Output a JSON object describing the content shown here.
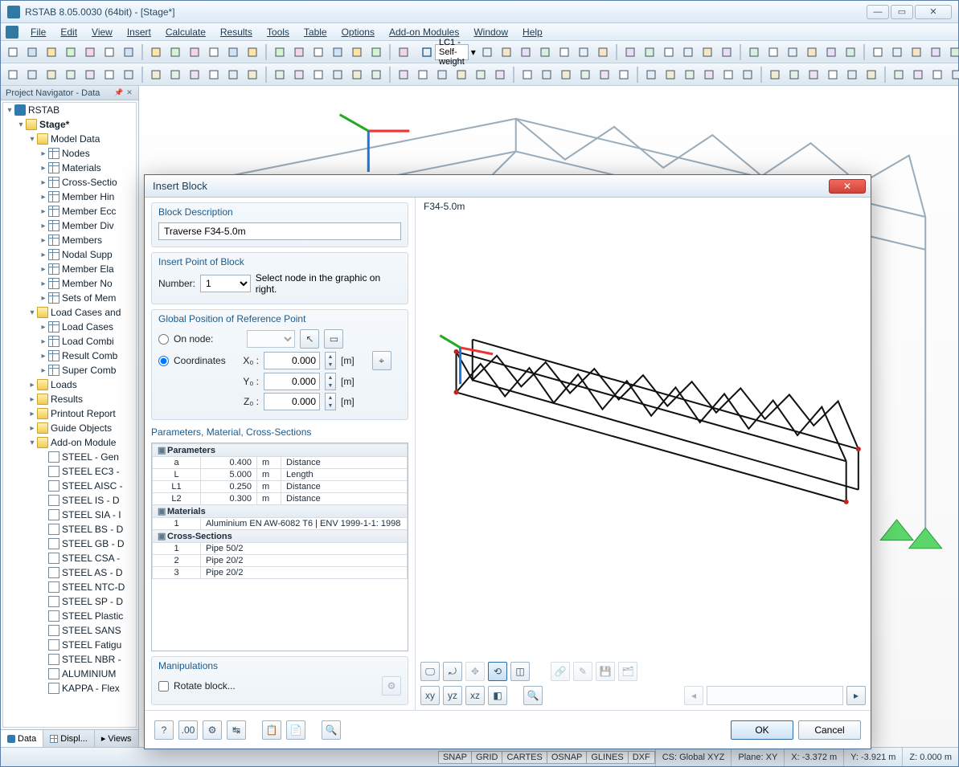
{
  "window": {
    "title": "RSTAB 8.05.0030 (64bit) - [Stage*]",
    "buttons": {
      "min": "—",
      "max": "▭",
      "close": "✕"
    }
  },
  "menubar": [
    "File",
    "Edit",
    "View",
    "Insert",
    "Calculate",
    "Results",
    "Tools",
    "Table",
    "Options",
    "Add-on Modules",
    "Window",
    "Help"
  ],
  "loadcase_combo": "LC1 - Self-weight",
  "navigator": {
    "title": "Project Navigator - Data",
    "tabs": [
      "Data",
      "Displ...",
      "Views"
    ],
    "root": "RSTAB",
    "project": "Stage*",
    "model_data_label": "Model Data",
    "model_data": [
      "Nodes",
      "Materials",
      "Cross-Sectio",
      "Member Hin",
      "Member Ecc",
      "Member Div",
      "Members",
      "Nodal Supp",
      "Member Ela",
      "Member No",
      "Sets of Mem"
    ],
    "loadcases_label": "Load Cases and",
    "loadcases": [
      "Load Cases",
      "Load Combi",
      "Result Comb",
      "Super Comb"
    ],
    "others": [
      "Loads",
      "Results",
      "Printout Report",
      "Guide Objects"
    ],
    "addon_label": "Add-on Module",
    "addons": [
      "STEEL - Gen",
      "STEEL EC3 -",
      "STEEL AISC -",
      "STEEL IS - D",
      "STEEL SIA - I",
      "STEEL BS - D",
      "STEEL GB - D",
      "STEEL CSA -",
      "STEEL AS - D",
      "STEEL NTC-D",
      "STEEL SP - D",
      "STEEL Plastic",
      "STEEL SANS ",
      "STEEL Fatigu",
      "STEEL NBR -",
      "ALUMINIUM",
      "KAPPA - Flex"
    ]
  },
  "dialog": {
    "title": "Insert Block",
    "groups": {
      "desc": {
        "legend": "Block Description",
        "value": "Traverse F34-5.0m"
      },
      "insert": {
        "legend": "Insert Point of Block",
        "number_label": "Number:",
        "number_value": "1",
        "hint": "Select node in the graphic on right."
      },
      "global": {
        "legend": "Global Position of Reference Point",
        "on_node": "On node:",
        "coords": "Coordinates",
        "x_label": "X₀ :",
        "x_val": "0.000",
        "x_unit": "[m]",
        "y_label": "Y₀ :",
        "y_val": "0.000",
        "y_unit": "[m]",
        "z_label": "Z₀ :",
        "z_val": "0.000",
        "z_unit": "[m]"
      },
      "params": {
        "legend": "Parameters, Material, Cross-Sections",
        "sections": {
          "parameters": "Parameters",
          "materials": "Materials",
          "cross": "Cross-Sections"
        },
        "rows": [
          {
            "k": "a",
            "v": "0.400",
            "u": "m",
            "d": "Distance"
          },
          {
            "k": "L",
            "v": "5.000",
            "u": "m",
            "d": "Length"
          },
          {
            "k": "L1",
            "v": "0.250",
            "u": "m",
            "d": "Distance"
          },
          {
            "k": "L2",
            "v": "0.300",
            "u": "m",
            "d": "Distance"
          }
        ],
        "materials": [
          {
            "n": "1",
            "t": "Aluminium EN AW-6082 T6 | ENV 1999-1-1: 1998"
          }
        ],
        "cross": [
          {
            "n": "1",
            "t": "Pipe 50/2"
          },
          {
            "n": "2",
            "t": "Pipe 20/2"
          },
          {
            "n": "3",
            "t": "Pipe 20/2"
          }
        ]
      },
      "manip": {
        "legend": "Manipulations",
        "rotate": "Rotate block..."
      }
    },
    "preview_title": "F34-5.0m",
    "buttons": {
      "ok": "OK",
      "cancel": "Cancel"
    }
  },
  "statusbar": {
    "toggles": [
      "SNAP",
      "GRID",
      "CARTES",
      "OSNAP",
      "GLINES",
      "DXF"
    ],
    "cs": "CS: Global XYZ",
    "plane": "Plane: XY",
    "x": "X: -3.372 m",
    "y": "Y: -3.921 m",
    "z": "Z: 0.000 m"
  }
}
